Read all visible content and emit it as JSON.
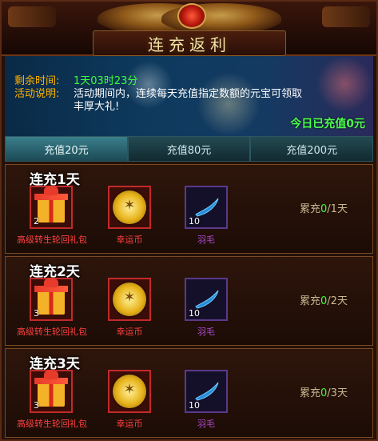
{
  "title": "连充返利",
  "info": {
    "remaining_label": "剩余时间:",
    "remaining_value": "1天03时23分",
    "desc_label": "活动说明:",
    "desc_line1": "活动期间内，连续每天充值指定数额的元宝可领取",
    "desc_line2": "丰厚大礼!",
    "today": "今日已充值0元"
  },
  "tabs": [
    {
      "label": "充值20元",
      "active": true
    },
    {
      "label": "充值80元",
      "active": false
    },
    {
      "label": "充值200元",
      "active": false
    }
  ],
  "tasks": [
    {
      "day": "连充1天",
      "items": [
        {
          "name": "高级转生轮回礼包",
          "count": "2",
          "icon": "gift-icon"
        },
        {
          "name": "幸运币",
          "count": "",
          "icon": "coin-icon"
        },
        {
          "name": "羽毛",
          "count": "10",
          "icon": "feather-icon"
        }
      ],
      "progress_label": "累充",
      "progress_current": "0",
      "progress_total": "/1天"
    },
    {
      "day": "连充2天",
      "items": [
        {
          "name": "高级转生轮回礼包",
          "count": "3",
          "icon": "gift-icon"
        },
        {
          "name": "幸运币",
          "count": "",
          "icon": "coin-icon"
        },
        {
          "name": "羽毛",
          "count": "10",
          "icon": "feather-icon"
        }
      ],
      "progress_label": "累充",
      "progress_current": "0",
      "progress_total": "/2天"
    },
    {
      "day": "连充3天",
      "items": [
        {
          "name": "高级转生轮回礼包",
          "count": "3",
          "icon": "gift-icon"
        },
        {
          "name": "幸运币",
          "count": "",
          "icon": "coin-icon"
        },
        {
          "name": "羽毛",
          "count": "10",
          "icon": "feather-icon"
        }
      ],
      "progress_label": "累充",
      "progress_current": "0",
      "progress_total": "/3天"
    }
  ],
  "colors": {
    "accent": "#3cff3c",
    "label": "#ffb400",
    "item_red": "#ff4040",
    "item_purple": "#b04ad0"
  }
}
